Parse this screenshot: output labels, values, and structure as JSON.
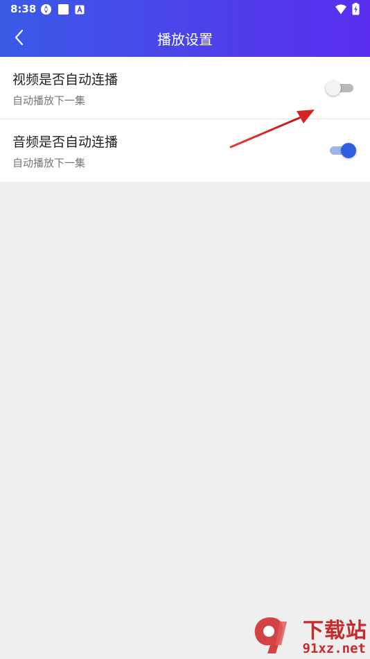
{
  "status_bar": {
    "time": "8:38",
    "icons": [
      "app-icon",
      "square-icon",
      "a-badge-icon",
      "wifi-icon",
      "battery-icon"
    ]
  },
  "app_bar": {
    "title": "播放设置",
    "back_icon": "chevron-left-icon",
    "background_colors": [
      "#3a5be6",
      "#5a2fef"
    ]
  },
  "settings": [
    {
      "title": "视频是否自动连播",
      "subtitle": "自动播放下一集",
      "enabled": false
    },
    {
      "title": "音频是否自动连播",
      "subtitle": "自动播放下一集",
      "enabled": true
    }
  ],
  "annotation": {
    "type": "red-arrow",
    "color": "#d42323"
  },
  "watermark": {
    "logo_text": "下载站",
    "url_text": "91xz.net",
    "color": "#c62a2a"
  }
}
